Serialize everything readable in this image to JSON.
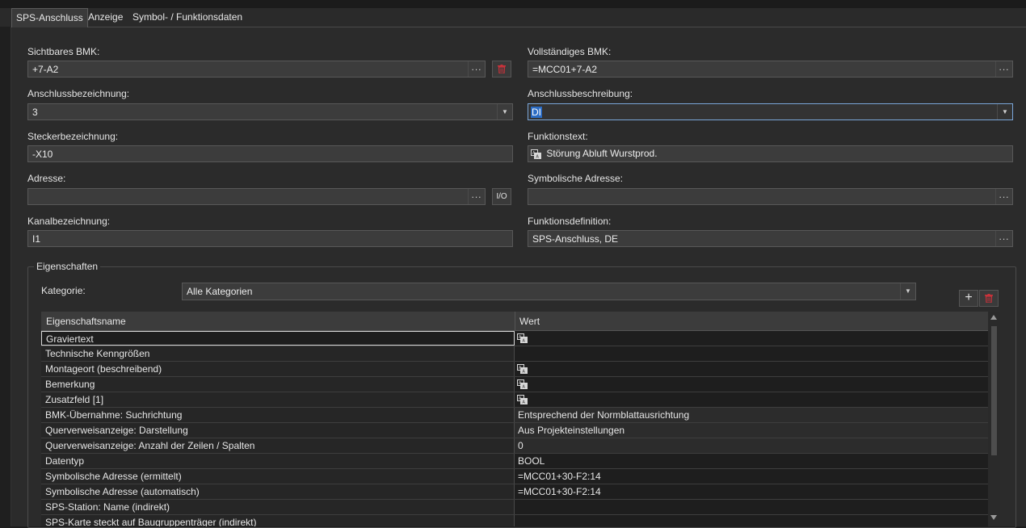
{
  "tabs": [
    {
      "label": "SPS-Anschluss",
      "active": true
    },
    {
      "label": "Anzeige",
      "active": false
    },
    {
      "label": "Symbol- / Funktionsdaten",
      "active": false
    }
  ],
  "fields": {
    "sichtbares_bmk": {
      "label": "Sichtbares BMK:",
      "value": "+7-A2"
    },
    "vollstaendiges_bmk": {
      "label": "Vollständiges BMK:",
      "value": "=MCC01+7-A2"
    },
    "anschlussbezeichnung": {
      "label": "Anschlussbezeichnung:",
      "value": "3"
    },
    "anschlussbeschreibung": {
      "label": "Anschlussbeschreibung:",
      "value": "DI"
    },
    "steckerbezeichnung": {
      "label": "Steckerbezeichnung:",
      "value": "-X10"
    },
    "funktionstext": {
      "label": "Funktionstext:",
      "value": "Störung Abluft Wurstprod."
    },
    "adresse": {
      "label": "Adresse:",
      "value": ""
    },
    "symbolische_adresse": {
      "label": "Symbolische Adresse:",
      "value": ""
    },
    "kanalbezeichnung": {
      "label": "Kanalbezeichnung:",
      "value": "I1"
    },
    "funktionsdefinition": {
      "label": "Funktionsdefinition:",
      "value": "SPS-Anschluss, DE"
    }
  },
  "buttons": {
    "dots": "...",
    "io": "I/O",
    "add": "+"
  },
  "eigenschaften": {
    "title": "Eigenschaften",
    "kategorie_label": "Kategorie:",
    "kategorie_value": "Alle Kategorien",
    "columns": [
      "Eigenschaftsname",
      "Wert"
    ],
    "rows": [
      {
        "name": "Graviertext",
        "value": "",
        "icon": true
      },
      {
        "name": "Technische Kenngrößen",
        "value": "",
        "icon": false
      },
      {
        "name": "Montageort (beschreibend)",
        "value": "",
        "icon": true
      },
      {
        "name": "Bemerkung",
        "value": "",
        "icon": true
      },
      {
        "name": "Zusatzfeld [1]",
        "value": "",
        "icon": true
      },
      {
        "name": "BMK-Übernahme: Suchrichtung",
        "value": "Entsprechend der Normblattausrichtung",
        "icon": false
      },
      {
        "name": "Querverweisanzeige: Darstellung",
        "value": "Aus Projekteinstellungen",
        "icon": false
      },
      {
        "name": "Querverweisanzeige: Anzahl der Zeilen / Spalten",
        "value": "0",
        "icon": false
      },
      {
        "name": "Datentyp",
        "value": "BOOL",
        "icon": false
      },
      {
        "name": "Symbolische Adresse (ermittelt)",
        "value": "=MCC01+30-F2:14",
        "icon": false
      },
      {
        "name": "Symbolische Adresse (automatisch)",
        "value": "=MCC01+30-F2:14",
        "icon": false
      },
      {
        "name": "SPS-Station: Name (indirekt)",
        "value": "",
        "icon": false
      },
      {
        "name": "SPS-Karte steckt auf Baugruppenträger (indirekt)",
        "value": "",
        "icon": false
      }
    ]
  },
  "colors": {
    "accent": "#2b6cc4",
    "delete": "#c8323a",
    "panel": "#2b2b2b"
  }
}
